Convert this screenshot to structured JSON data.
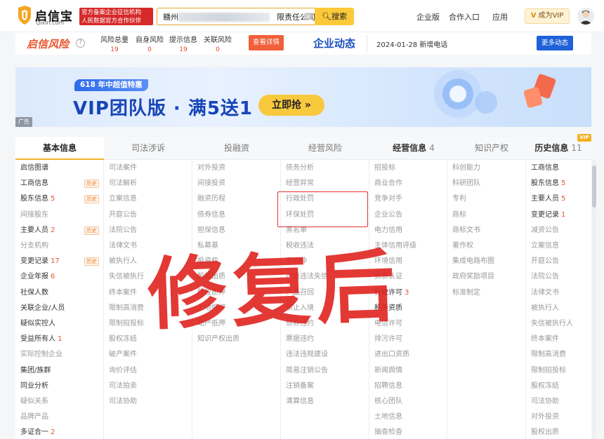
{
  "header": {
    "logo_cn": "启信宝",
    "logo_en": "Qixin.com",
    "official_badge": [
      "官方备案企业征信机构",
      "人民数据官方合作伙伴"
    ],
    "search_prefix": "赣州",
    "search_suffix": "限责任公司",
    "search_label": "搜索",
    "nav": [
      "企业版",
      "合作入口",
      "应用"
    ],
    "vip_v": "V",
    "vip_label": "成为VIP"
  },
  "risk": {
    "logo": "启信风险",
    "help": "?",
    "metrics": [
      {
        "label": "风险总量",
        "value": "19"
      },
      {
        "label": "自身风险",
        "value": "0"
      },
      {
        "label": "提示信息",
        "value": "19"
      },
      {
        "label": "关联风险",
        "value": "0"
      }
    ],
    "detail_btn": "查看详情",
    "news_logo": "企业动态",
    "news_text": "2024-01-28 新增电话",
    "more_btn": "更多动态"
  },
  "banner": {
    "sub": "618  年中超值特惠",
    "title": "VIP团队版 · 满5送1",
    "btn": "立即抢 »",
    "ad": "广告"
  },
  "tabs": [
    {
      "label": "基本信息",
      "count": ""
    },
    {
      "label": "司法涉诉",
      "count": ""
    },
    {
      "label": "投融资",
      "count": ""
    },
    {
      "label": "经营风险",
      "count": ""
    },
    {
      "label": "经营信息",
      "count": "4"
    },
    {
      "label": "知识产权",
      "count": ""
    },
    {
      "label": "历史信息",
      "count": "11"
    }
  ],
  "vip_corner": "VIP",
  "columns": [
    [
      {
        "t": "启信图谱",
        "on": true
      },
      {
        "t": "工商信息",
        "on": true,
        "hist": "历史"
      },
      {
        "t": "股东信息",
        "n": "5",
        "on": true,
        "hist": "历史"
      },
      {
        "t": "间接股东",
        "on": false
      },
      {
        "t": "主要人员",
        "n": "2",
        "on": true,
        "hist": "历史"
      },
      {
        "t": "分支机构",
        "on": false
      },
      {
        "t": "变更记录",
        "n": "17",
        "on": true,
        "hist": "历史"
      },
      {
        "t": "企业年报",
        "n": "6",
        "on": true
      },
      {
        "t": "社保人数",
        "on": true
      },
      {
        "t": "关联企业/人员",
        "on": true
      },
      {
        "t": "疑似实控人",
        "on": true
      },
      {
        "t": "受益所有人",
        "n": "1",
        "on": true
      },
      {
        "t": "实际控制企业",
        "on": false
      },
      {
        "t": "集团/族群",
        "on": true
      },
      {
        "t": "同业分析",
        "on": true
      },
      {
        "t": "疑似关系",
        "on": false
      },
      {
        "t": "品牌产品",
        "on": false
      },
      {
        "t": "多证合一",
        "n": "2",
        "on": true
      }
    ],
    [
      {
        "t": "司法案件",
        "on": false
      },
      {
        "t": "司法解析",
        "on": false
      },
      {
        "t": "立案信息",
        "on": false
      },
      {
        "t": "开庭公告",
        "on": false
      },
      {
        "t": "法院公告",
        "on": false
      },
      {
        "t": "法律文书",
        "on": false
      },
      {
        "t": "被执行人",
        "on": false
      },
      {
        "t": "失信被执行",
        "on": false
      },
      {
        "t": "终本案件",
        "on": false
      },
      {
        "t": "限制高消费",
        "on": false
      },
      {
        "t": "限制招投标",
        "on": false
      },
      {
        "t": "股权冻结",
        "on": false
      },
      {
        "t": "破产案件",
        "on": false
      },
      {
        "t": "询价评估",
        "on": false
      },
      {
        "t": "司法拍卖",
        "on": false
      },
      {
        "t": "司法协助",
        "on": false
      }
    ],
    [
      {
        "t": "对外投资",
        "on": false
      },
      {
        "t": "间接投资",
        "on": false
      },
      {
        "t": "融资历程",
        "on": false
      },
      {
        "t": "债券信息",
        "on": false
      },
      {
        "t": "担保信息",
        "on": false
      },
      {
        "t": "私募基",
        "on": false
      },
      {
        "t": "投资机",
        "on": false
      },
      {
        "t": "股权出质",
        "on": false
      },
      {
        "t": "股权质押",
        "on": false
      },
      {
        "t": "土地抵押",
        "on": false
      },
      {
        "t": "动产抵押",
        "on": false
      },
      {
        "t": "知识产权出质",
        "on": false
      }
    ],
    [
      {
        "t": "债务分析",
        "on": false
      },
      {
        "t": "经营异常",
        "on": false
      },
      {
        "t": "行政处罚",
        "on": false
      },
      {
        "t": "环保处罚",
        "on": false
      },
      {
        "t": "黑名单",
        "on": false
      },
      {
        "t": "税收违法",
        "on": false
      },
      {
        "t": "劳动仲",
        "on": false
      },
      {
        "t": "严重违法失信",
        "on": false
      },
      {
        "t": "产品召回",
        "on": false
      },
      {
        "t": "禁止入境",
        "on": false
      },
      {
        "t": "债券违约",
        "on": false
      },
      {
        "t": "票据违约",
        "on": false
      },
      {
        "t": "违法违规建设",
        "on": false
      },
      {
        "t": "简易注销公告",
        "on": false
      },
      {
        "t": "注销备案",
        "on": false
      },
      {
        "t": "清算信息",
        "on": false
      }
    ],
    [
      {
        "t": "招投标",
        "on": false
      },
      {
        "t": "商业合作",
        "on": false
      },
      {
        "t": "竞争对手",
        "on": false
      },
      {
        "t": "企业公告",
        "on": false
      },
      {
        "t": "电力信用",
        "on": false
      },
      {
        "t": "主体信用评级",
        "on": false
      },
      {
        "t": "环境信用",
        "on": false
      },
      {
        "t": "资质认证",
        "on": false
      },
      {
        "t": "行政许可",
        "n": "3",
        "on": true
      },
      {
        "t": "税务资质",
        "on": true
      },
      {
        "t": "电信许可",
        "on": false
      },
      {
        "t": "排污许可",
        "on": false
      },
      {
        "t": "进出口资质",
        "on": false
      },
      {
        "t": "新闻舆情",
        "on": false
      },
      {
        "t": "招聘信息",
        "on": false
      },
      {
        "t": "核心团队",
        "on": false
      },
      {
        "t": "土地信息",
        "on": false
      },
      {
        "t": "抽查检查",
        "on": false
      }
    ],
    [
      {
        "t": "科创能力",
        "on": false
      },
      {
        "t": "科研团队",
        "on": false
      },
      {
        "t": "专利",
        "on": false
      },
      {
        "t": "商标",
        "on": false
      },
      {
        "t": "商标文书",
        "on": false
      },
      {
        "t": "著作权",
        "on": false
      },
      {
        "t": "集成电路布图",
        "on": false
      },
      {
        "t": "政府奖励项目",
        "on": false
      },
      {
        "t": "标准制定",
        "on": false
      }
    ],
    [
      {
        "t": "工商信息",
        "on": true
      },
      {
        "t": "股东信息",
        "n": "5",
        "on": true
      },
      {
        "t": "主要人员",
        "n": "5",
        "on": true
      },
      {
        "t": "变更记录",
        "n": "1",
        "on": true
      },
      {
        "t": "减资公告",
        "on": false
      },
      {
        "t": "立案信息",
        "on": false
      },
      {
        "t": "开庭公告",
        "on": false
      },
      {
        "t": "法院公告",
        "on": false
      },
      {
        "t": "法律文书",
        "on": false
      },
      {
        "t": "被执行人",
        "on": false
      },
      {
        "t": "失信被执行人",
        "on": false
      },
      {
        "t": "终本案件",
        "on": false
      },
      {
        "t": "限制高消费",
        "on": false
      },
      {
        "t": "限制招投标",
        "on": false
      },
      {
        "t": "股权冻结",
        "on": false
      },
      {
        "t": "司法协助",
        "on": false
      },
      {
        "t": "对外投资",
        "on": false
      },
      {
        "t": "股权出质",
        "on": false
      }
    ]
  ],
  "watermark": "修复后",
  "colors": {
    "accent": "#f1b226",
    "risk": "#e8562e",
    "brand_blue": "#1e61d8",
    "highlight": "#e2312f"
  }
}
